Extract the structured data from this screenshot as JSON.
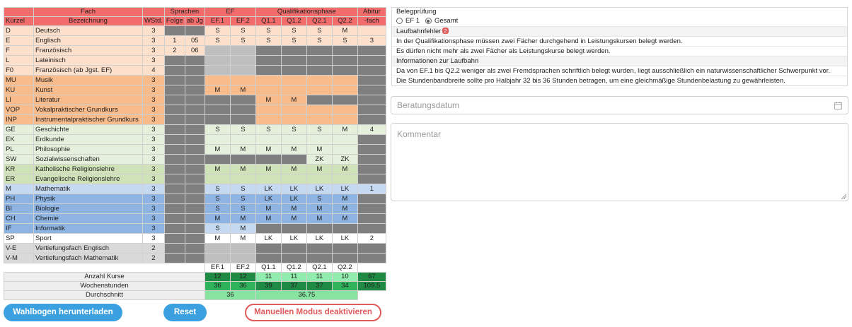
{
  "colors": {
    "lang": "#fde0cc",
    "lang_strong": "#f9c7a3",
    "arts": "#f8bb8c",
    "social": "#e4f0dc",
    "religion": "#d0e2b8",
    "math": "#c5d9f1",
    "science": "#8db4e2",
    "sport": "#ffffff",
    "vertiefung": "#d9d9d9",
    "header": "#f26c6c",
    "green_dark": "#1f8a43",
    "green_mid": "#2fb35a",
    "green_light": "#92ecad",
    "green_avg": "#86e4a0"
  },
  "headers": {
    "fach": "Fach",
    "kuerzel": "Kürzel",
    "bezeichnung": "Bezeichnung",
    "wstd": "WStd.",
    "sprachen": "Sprachen",
    "folge": "Folge",
    "ab_jg": "ab Jg",
    "ef": "EF",
    "ef1": "EF.1",
    "ef2": "EF.2",
    "qphase": "Qualifikationsphase",
    "q11": "Q1.1",
    "q12": "Q1.2",
    "q21": "Q2.1",
    "q22": "Q2.2",
    "abitur": "Abitur",
    "abitur2": "-fach"
  },
  "subjects": [
    {
      "k": "D",
      "name": "Deutsch",
      "w": "3",
      "f": "",
      "j": "",
      "ef1": "S",
      "ef2": "S",
      "q11": "S",
      "q12": "S",
      "q21": "S",
      "q22": "M",
      "abi": ""
    },
    {
      "k": "E",
      "name": "Englisch",
      "w": "3",
      "f": "1",
      "j": "05",
      "ef1": "S",
      "ef2": "S",
      "q11": "S",
      "q12": "S",
      "q21": "S",
      "q22": "S",
      "abi": "3"
    },
    {
      "k": "F",
      "name": "Französisch",
      "w": "3",
      "f": "2",
      "j": "06",
      "ef1": "",
      "ef2": "",
      "q11": "",
      "q12": "",
      "q21": "",
      "q22": "",
      "abi": ""
    },
    {
      "k": "L",
      "name": "Lateinisch",
      "w": "3",
      "f": "",
      "j": "",
      "ef1": "",
      "ef2": "",
      "q11": "",
      "q12": "",
      "q21": "",
      "q22": "",
      "abi": ""
    },
    {
      "k": "F0",
      "name": "Französisch (ab Jgst. EF)",
      "w": "4",
      "f": "",
      "j": "",
      "ef1": "",
      "ef2": "",
      "q11": "",
      "q12": "",
      "q21": "",
      "q22": "",
      "abi": ""
    },
    {
      "k": "MU",
      "name": "Musik",
      "w": "3",
      "f": "",
      "j": "",
      "ef1": "",
      "ef2": "",
      "q11": "",
      "q12": "",
      "q21": "",
      "q22": "",
      "abi": ""
    },
    {
      "k": "KU",
      "name": "Kunst",
      "w": "3",
      "f": "",
      "j": "",
      "ef1": "M",
      "ef2": "M",
      "q11": "",
      "q12": "",
      "q21": "",
      "q22": "",
      "abi": ""
    },
    {
      "k": "LI",
      "name": "Literatur",
      "w": "3",
      "f": "",
      "j": "",
      "ef1": "",
      "ef2": "",
      "q11": "M",
      "q12": "M",
      "q21": "",
      "q22": "",
      "abi": ""
    },
    {
      "k": "VOP",
      "name": "Vokalpraktischer Grundkurs",
      "w": "3",
      "f": "",
      "j": "",
      "ef1": "",
      "ef2": "",
      "q11": "",
      "q12": "",
      "q21": "",
      "q22": "",
      "abi": ""
    },
    {
      "k": "INP",
      "name": "Instrumentalpraktischer Grundkurs",
      "w": "3",
      "f": "",
      "j": "",
      "ef1": "",
      "ef2": "",
      "q11": "",
      "q12": "",
      "q21": "",
      "q22": "",
      "abi": ""
    },
    {
      "k": "GE",
      "name": "Geschichte",
      "w": "3",
      "f": "",
      "j": "",
      "ef1": "S",
      "ef2": "S",
      "q11": "S",
      "q12": "S",
      "q21": "S",
      "q22": "M",
      "abi": "4"
    },
    {
      "k": "EK",
      "name": "Erdkunde",
      "w": "3",
      "f": "",
      "j": "",
      "ef1": "",
      "ef2": "",
      "q11": "",
      "q12": "",
      "q21": "",
      "q22": "",
      "abi": ""
    },
    {
      "k": "PL",
      "name": "Philosophie",
      "w": "3",
      "f": "",
      "j": "",
      "ef1": "M",
      "ef2": "M",
      "q11": "M",
      "q12": "M",
      "q21": "M",
      "q22": "",
      "abi": ""
    },
    {
      "k": "SW",
      "name": "Sozialwissenschaften",
      "w": "3",
      "f": "",
      "j": "",
      "ef1": "",
      "ef2": "",
      "q11": "",
      "q12": "",
      "q21": "ZK",
      "q22": "ZK",
      "abi": ""
    },
    {
      "k": "KR",
      "name": "Katholische Religionslehre",
      "w": "3",
      "f": "",
      "j": "",
      "ef1": "M",
      "ef2": "M",
      "q11": "M",
      "q12": "M",
      "q21": "M",
      "q22": "M",
      "abi": ""
    },
    {
      "k": "ER",
      "name": "Evangelische Religionslehre",
      "w": "3",
      "f": "",
      "j": "",
      "ef1": "",
      "ef2": "",
      "q11": "",
      "q12": "",
      "q21": "",
      "q22": "",
      "abi": ""
    },
    {
      "k": "M",
      "name": "Mathematik",
      "w": "3",
      "f": "",
      "j": "",
      "ef1": "S",
      "ef2": "S",
      "q11": "LK",
      "q12": "LK",
      "q21": "LK",
      "q22": "LK",
      "abi": "1"
    },
    {
      "k": "PH",
      "name": "Physik",
      "w": "3",
      "f": "",
      "j": "",
      "ef1": "S",
      "ef2": "S",
      "q11": "LK",
      "q12": "LK",
      "q21": "S",
      "q22": "M",
      "abi": ""
    },
    {
      "k": "BI",
      "name": "Biologie",
      "w": "3",
      "f": "",
      "j": "",
      "ef1": "S",
      "ef2": "S",
      "q11": "M",
      "q12": "M",
      "q21": "M",
      "q22": "M",
      "abi": ""
    },
    {
      "k": "CH",
      "name": "Chemie",
      "w": "3",
      "f": "",
      "j": "",
      "ef1": "M",
      "ef2": "M",
      "q11": "M",
      "q12": "M",
      "q21": "M",
      "q22": "M",
      "abi": ""
    },
    {
      "k": "IF",
      "name": "Informatik",
      "w": "3",
      "f": "",
      "j": "",
      "ef1": "S",
      "ef2": "M",
      "q11": "",
      "q12": "",
      "q21": "",
      "q22": "",
      "abi": ""
    },
    {
      "k": "SP",
      "name": "Sport",
      "w": "3",
      "f": "",
      "j": "",
      "ef1": "M",
      "ef2": "M",
      "q11": "LK",
      "q12": "LK",
      "q21": "LK",
      "q22": "LK",
      "abi": "2"
    },
    {
      "k": "V-E",
      "name": "Vertiefungsfach Englisch",
      "w": "2",
      "f": "",
      "j": "",
      "ef1": "",
      "ef2": "",
      "q11": "",
      "q12": "",
      "q21": "",
      "q22": "",
      "abi": ""
    },
    {
      "k": "V-M",
      "name": "Vertiefungsfach Mathematik",
      "w": "2",
      "f": "",
      "j": "",
      "ef1": "",
      "ef2": "",
      "q11": "",
      "q12": "",
      "q21": "",
      "q22": "",
      "abi": ""
    }
  ],
  "footer": {
    "periods": [
      "EF.1",
      "EF.2",
      "Q1.1",
      "Q1.2",
      "Q2.1",
      "Q2.2"
    ],
    "anzahl_label": "Anzahl Kurse",
    "anzahl": [
      "12",
      "12",
      "11",
      "11",
      "11",
      "10",
      "67"
    ],
    "wochen_label": "Wochenstunden",
    "wochen": [
      "36",
      "36",
      "39",
      "37",
      "37",
      "34",
      "109.5"
    ],
    "avg_label": "Durchschnitt",
    "avg_ef": "36",
    "avg_q": "36.75"
  },
  "buttons": {
    "download": "Wahlbogen herunterladen",
    "reset": "Reset",
    "manual": "Manuellen Modus deaktivieren"
  },
  "beleg": {
    "title": "Belegprüfung",
    "opt1": "EF 1",
    "opt2": "Gesamt",
    "selected": "Gesamt"
  },
  "fehler": {
    "title": "Laufbahnfehler",
    "count": "2",
    "items": [
      "In der Qualifikationsphase müssen zwei Fächer durchgehend in Leistungskursen belegt werden.",
      "Es dürfen nicht mehr als zwei Fächer als Leistungskurse belegt werden."
    ]
  },
  "info": {
    "title": "Informationen zur Laufbahn",
    "items": [
      "Da von EF.1 bis Q2.2 weniger als zwei Fremdsprachen schriftlich belegt wurden, liegt ausschließlich ein naturwissenschaftlicher Schwerpunkt vor.",
      "Die Stundenbandbreite sollte pro Halbjahr 32 bis 36 Stunden betragen, um eine gleichmäßige Stundenbelastung zu gewährleisten."
    ]
  },
  "beratungsdatum": {
    "placeholder": "Beratungsdatum",
    "icon": "calendar-icon"
  },
  "kommentar": {
    "placeholder": "Kommentar"
  }
}
